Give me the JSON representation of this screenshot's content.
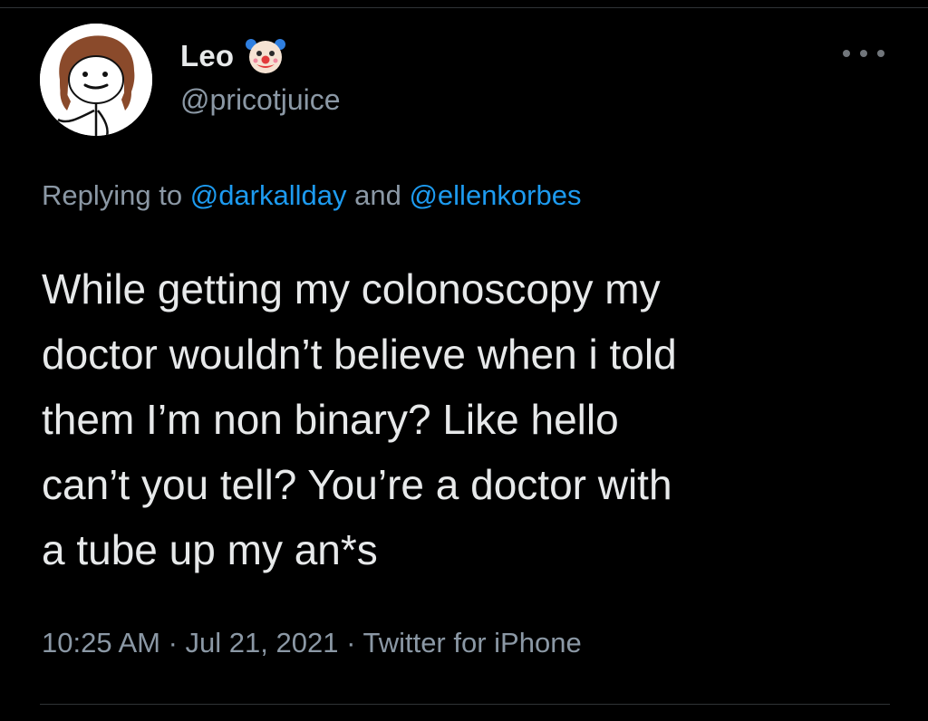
{
  "user": {
    "display_name": "Leo",
    "handle": "@pricotjuice",
    "avatar_icon": "stick-figure-avatar",
    "badge_icon": "clown-face-emoji"
  },
  "reply": {
    "prefix": "Replying to ",
    "mention_1": "@darkallday",
    "joiner": " and ",
    "mention_2": "@ellenkorbes"
  },
  "tweet": {
    "text": "While getting my colonoscopy my\ndoctor wouldn’t believe when i told\nthem I’m non binary? Like hello\ncan’t you tell? You’re a doctor with\na tube up my an*s"
  },
  "meta": {
    "time": "10:25 AM",
    "sep_1": " · ",
    "date": "Jul 21, 2021",
    "sep_2": " · ",
    "source": "Twitter for iPhone"
  },
  "colors": {
    "background": "#000000",
    "text_primary": "#e7e9ea",
    "text_secondary": "#8b98a5",
    "link_blue": "#1d9bf0",
    "divider": "#2f3336"
  }
}
